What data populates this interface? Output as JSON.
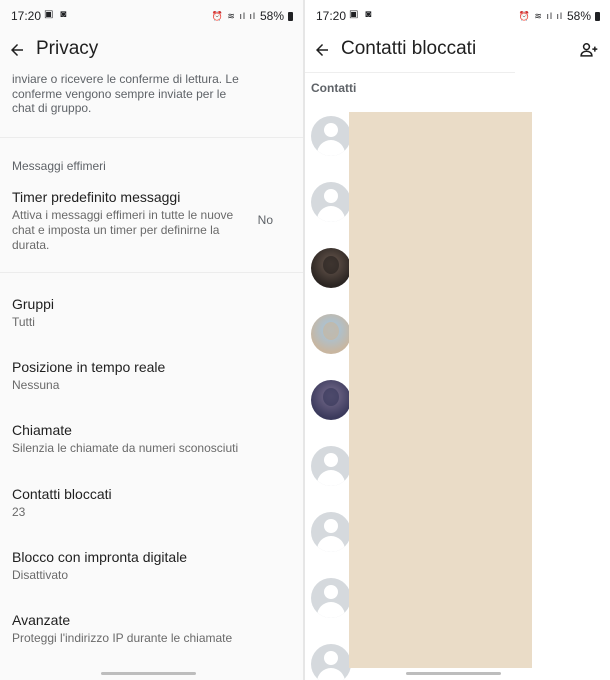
{
  "status": {
    "time": "17:20",
    "battery": "58%",
    "left_glyphs": "▣ ◙",
    "right_glyphs": "⏰ ≋ ıl ıl"
  },
  "privacy": {
    "title": "Privacy",
    "read_receipts_desc": "inviare o ricevere le conferme di lettura. Le conferme vengono sempre inviate per le chat di gruppo.",
    "ephemeral_section": "Messaggi effimeri",
    "timer": {
      "title": "Timer predefinito messaggi",
      "desc": "Attiva i messaggi effimeri in tutte le nuove chat e imposta un timer per definirne la durata.",
      "value": "No"
    },
    "items": [
      {
        "title": "Gruppi",
        "sub": "Tutti"
      },
      {
        "title": "Posizione in tempo reale",
        "sub": "Nessuna"
      },
      {
        "title": "Chiamate",
        "sub": "Silenzia le chiamate da numeri sconosciuti"
      },
      {
        "title": "Contatti bloccati",
        "sub": "23"
      },
      {
        "title": "Blocco con impronta digitale",
        "sub": "Disattivato"
      },
      {
        "title": "Avanzate",
        "sub": "Proteggi l'indirizzo IP durante le chiamate"
      }
    ]
  },
  "blocked": {
    "title": "Contatti bloccati",
    "section_label": "Contatti",
    "avatars": [
      {
        "type": "default"
      },
      {
        "type": "default"
      },
      {
        "type": "photo",
        "color_a": "#2b2522",
        "color_b": "#6b5a50"
      },
      {
        "type": "photo",
        "color_a": "#c8b6a0",
        "color_b": "#9ec7e8"
      },
      {
        "type": "photo",
        "color_a": "#3b3a5c",
        "color_b": "#7a6f8f"
      },
      {
        "type": "default"
      },
      {
        "type": "default"
      },
      {
        "type": "default"
      },
      {
        "type": "default"
      }
    ]
  },
  "colors": {
    "accent": "#1f1f1f",
    "redaction": "#eadcc7",
    "avatar_default": "#d5d9dd"
  }
}
